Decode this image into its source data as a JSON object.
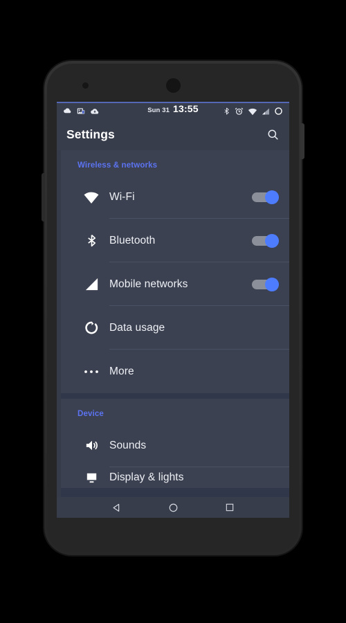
{
  "device": {
    "frame_color": "#2e2e2e",
    "screen_bg": "#31374a"
  },
  "status_bar": {
    "date": "Sun 31",
    "time": "13:55",
    "left_icons": [
      {
        "name": "cloud-icon",
        "label": "cloud"
      },
      {
        "name": "photos-badge-icon",
        "label": "photos with badge"
      },
      {
        "name": "cloud-upload-icon",
        "label": "cloud upload"
      }
    ],
    "right_icons": [
      {
        "name": "bluetooth-icon",
        "label": "bluetooth"
      },
      {
        "name": "alarm-icon",
        "label": "alarm"
      },
      {
        "name": "wifi-icon",
        "label": "wifi"
      },
      {
        "name": "signal-icon",
        "label": "cellular signal"
      },
      {
        "name": "battery-icon",
        "label": "battery"
      }
    ],
    "bg_color": "#373d4b"
  },
  "app_bar": {
    "title": "Settings",
    "search_icon": "search-icon",
    "bg_color": "#373d4b"
  },
  "sections": [
    {
      "header": "Wireless & networks",
      "header_color": "#5c73f2",
      "rows": [
        {
          "icon": "wifi-icon",
          "label": "Wi-Fi",
          "toggle": true,
          "toggle_on": true
        },
        {
          "icon": "bluetooth-icon",
          "label": "Bluetooth",
          "toggle": true,
          "toggle_on": true
        },
        {
          "icon": "signal-icon",
          "label": "Mobile networks",
          "toggle": true,
          "toggle_on": true
        },
        {
          "icon": "data-usage-icon",
          "label": "Data usage",
          "toggle": false,
          "toggle_on": false
        },
        {
          "icon": "more-icon",
          "label": "More",
          "toggle": false,
          "toggle_on": false
        }
      ]
    },
    {
      "header": "Device",
      "header_color": "#5c73f2",
      "rows": [
        {
          "icon": "sounds-icon",
          "label": "Sounds",
          "toggle": false,
          "toggle_on": false
        },
        {
          "icon": "display-icon",
          "label": "Display & lights",
          "toggle": false,
          "toggle_on": false,
          "partial": true
        }
      ]
    }
  ],
  "nav_bar": {
    "back": "back-icon",
    "home": "home-icon",
    "recents": "recents-icon"
  },
  "colors": {
    "accent": "#4d7cfe",
    "section_header": "#5c73f2",
    "card": "#3b4150",
    "divider": "#4a5162",
    "text_primary": "#eef0f5"
  }
}
